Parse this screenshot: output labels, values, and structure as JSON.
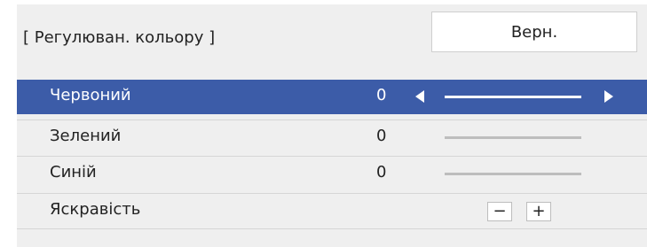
{
  "header": {
    "title": "[ Регулюван. кольору ]",
    "reset_label": "Верн."
  },
  "rows": [
    {
      "label": "Червоний",
      "value": "0"
    },
    {
      "label": "Зелений",
      "value": "0"
    },
    {
      "label": "Синій",
      "value": "0"
    },
    {
      "label": "Яскравість",
      "minus_label": "−",
      "plus_label": "+"
    }
  ],
  "colors": {
    "selection": "#3c5ca8",
    "panel_bg": "#efefef"
  },
  "icons": [
    "left-arrow-icon",
    "right-arrow-icon"
  ]
}
